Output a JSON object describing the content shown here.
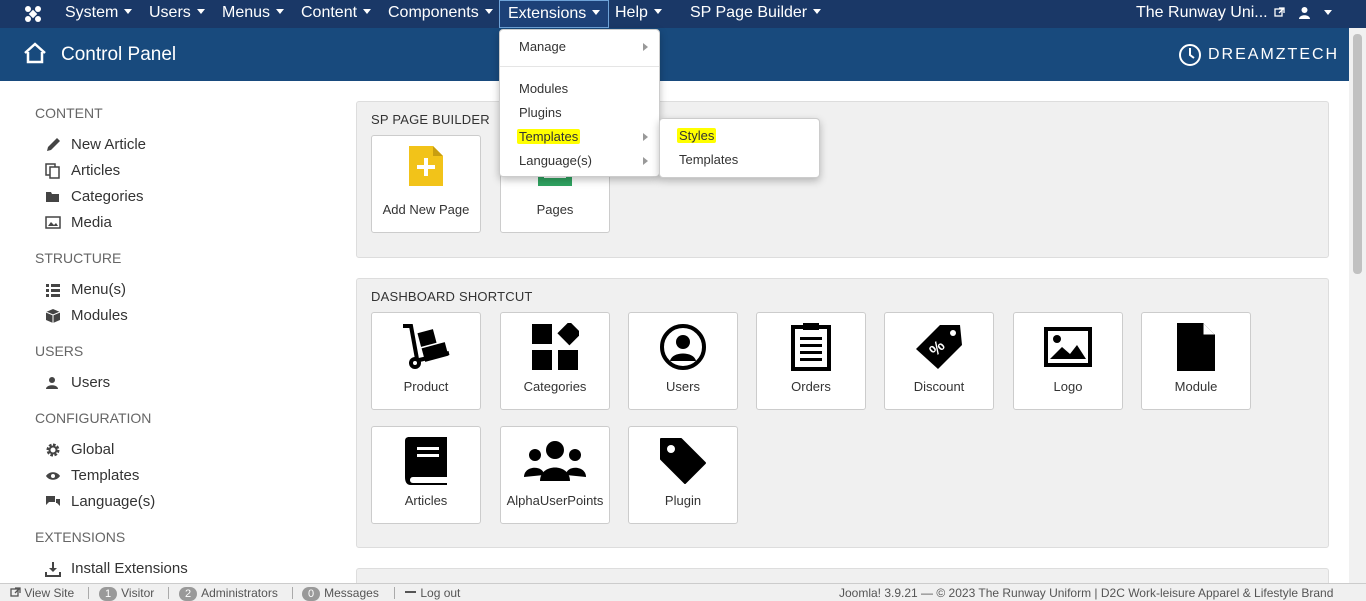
{
  "navbar": {
    "menus": [
      "System",
      "Users",
      "Menus",
      "Content",
      "Components",
      "Extensions",
      "Help",
      "SP Page Builder"
    ],
    "site_name": "The Runway Uni...",
    "user_icon": "user-icon"
  },
  "header": {
    "title": "Control Panel",
    "brand": "DREAMZTECH"
  },
  "sidebar": {
    "content_heading": "CONTENT",
    "content_items": [
      "New Article",
      "Articles",
      "Categories",
      "Media"
    ],
    "structure_heading": "STRUCTURE",
    "structure_items": [
      "Menu(s)",
      "Modules"
    ],
    "users_heading": "USERS",
    "users_items": [
      "Users"
    ],
    "configuration_heading": "CONFIGURATION",
    "configuration_items": [
      "Global",
      "Templates",
      "Language(s)"
    ],
    "extensions_heading": "EXTENSIONS",
    "extensions_items": [
      "Install Extensions"
    ]
  },
  "sp_panel": {
    "title": "SP PAGE BUILDER",
    "tiles": [
      "Add New Page",
      "Pages"
    ]
  },
  "dashboard_panel": {
    "title": "DASHBOARD SHORTCUT",
    "tiles": [
      "Product",
      "Categories",
      "Users",
      "Orders",
      "Discount",
      "Logo",
      "Module",
      "Articles",
      "AlphaUserPoints",
      "Plugin"
    ]
  },
  "extensions_menu": {
    "items": [
      "Manage",
      "Modules",
      "Plugins",
      "Templates",
      "Language(s)"
    ],
    "highlighted": "Templates"
  },
  "templates_submenu": {
    "items": [
      "Styles",
      "Templates"
    ],
    "highlighted": "Styles"
  },
  "footer": {
    "view_site": "View Site",
    "visitor_count": "1",
    "visitor_label": "Visitor",
    "admin_count": "2",
    "admin_label": "Administrators",
    "messages_count": "0",
    "messages_label": "Messages",
    "logout": "Log out",
    "copyright": "Joomla! 3.9.21  —  © 2023 The Runway Uniform | D2C Work-leisure Apparel & Lifestyle Brand"
  },
  "colors": {
    "navbar": "#1a3867",
    "header": "#184a7d",
    "highlight": "#ffff00"
  }
}
